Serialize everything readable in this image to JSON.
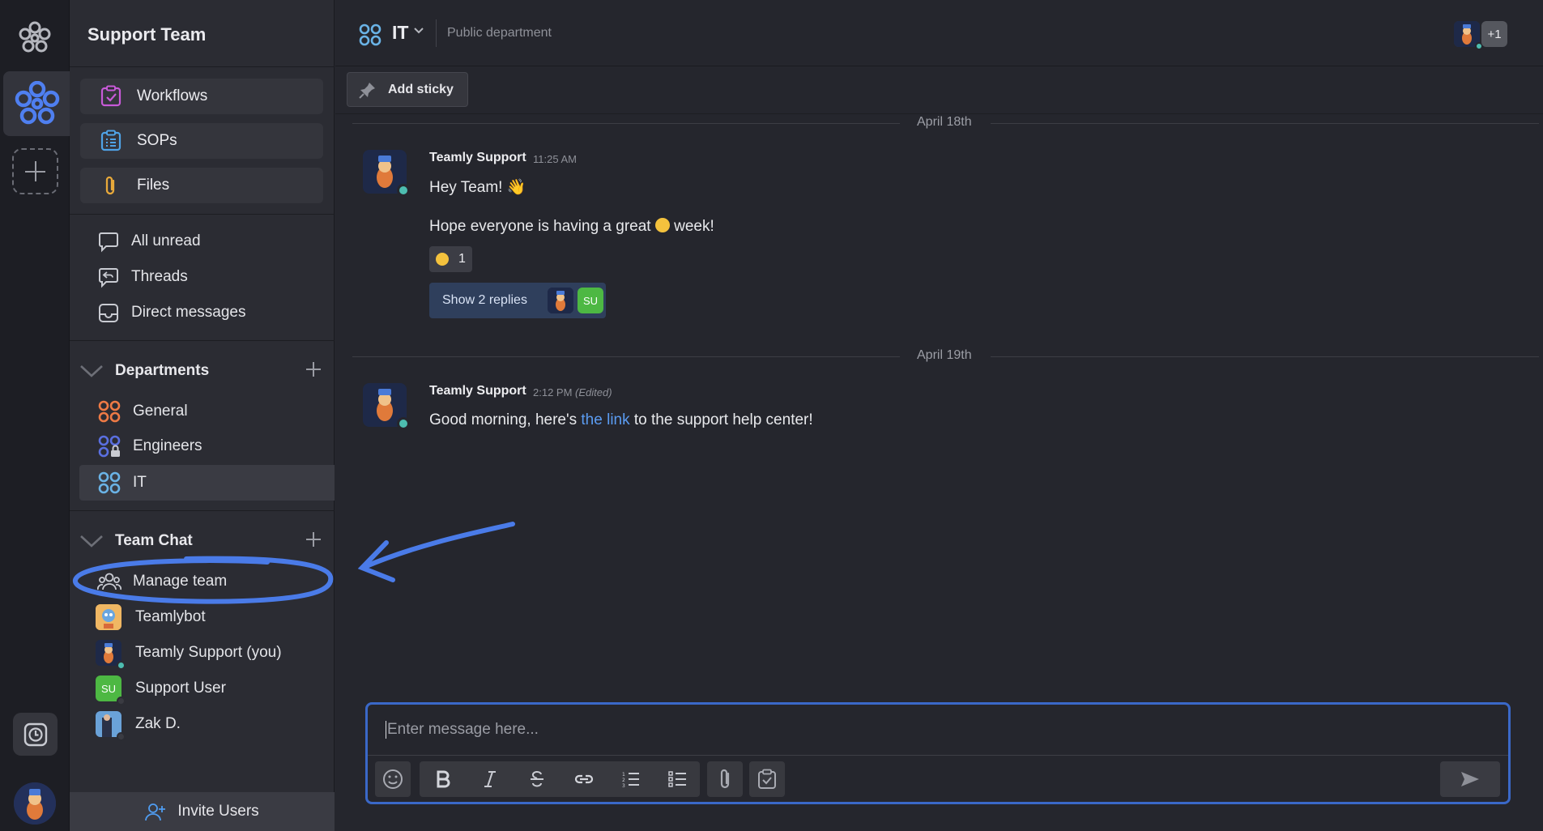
{
  "rail": {
    "home_icon": "flower-logo-icon",
    "active_workspace_icon": "flower-logo-icon",
    "add_workspace_icon": "plus-icon",
    "history_icon": "clock-icon"
  },
  "sidebar": {
    "team_title": "Support Team",
    "top_items": [
      {
        "label": "Workflows",
        "icon": "workflow-check-icon",
        "color": "#c85ad8"
      },
      {
        "label": "SOPs",
        "icon": "clipboard-list-icon",
        "color": "#4fa3e6"
      },
      {
        "label": "Files",
        "icon": "paperclip-icon",
        "color": "#e8a93a"
      }
    ],
    "nav": [
      {
        "label": "All unread",
        "icon": "chat-bubble-icon"
      },
      {
        "label": "Threads",
        "icon": "thread-reply-icon"
      },
      {
        "label": "Direct messages",
        "icon": "inbox-icon"
      }
    ],
    "departments": {
      "title": "Departments",
      "items": [
        {
          "label": "General",
          "color": "#ee7a45"
        },
        {
          "label": "Engineers",
          "color": "#5a6fe0"
        },
        {
          "label": "IT",
          "color": "#6ab3e6",
          "active": true
        }
      ]
    },
    "team_chat": {
      "title": "Team Chat",
      "manage_label": "Manage team",
      "users": [
        {
          "label": "Teamlybot",
          "avatar": "bot-avatar"
        },
        {
          "label": "Teamly Support (you)",
          "avatar": "support-avatar",
          "status": "#4dbdb0"
        },
        {
          "label": "Support User",
          "avatar": "SU",
          "status": "#3a3b42"
        },
        {
          "label": "Zak D.",
          "avatar": "zak-avatar",
          "status": "#3a3b42"
        }
      ]
    },
    "invite_label": "Invite Users"
  },
  "channel": {
    "name": "IT",
    "description": "Public department",
    "extra_members": "+1"
  },
  "toolbar": {
    "sticky_label": "Add sticky"
  },
  "messages": {
    "day1": "April 18th",
    "day2": "April 19th",
    "m1": {
      "author": "Teamly Support",
      "time": "11:25 AM",
      "line1": "Hey Team! 👋",
      "line2_a": "Hope everyone is having a great",
      "line2_b": "week!",
      "reaction_count": "1",
      "replies_label": "Show 2 replies",
      "reply_avatar_initials": "SU"
    },
    "m2": {
      "author": "Teamly Support",
      "time": "2:12 PM",
      "edited": "(Edited)",
      "text_a": "Good morning, here's",
      "link": "the link",
      "text_b": "to the support help center!"
    }
  },
  "composer": {
    "placeholder": "Enter message here...",
    "tools": [
      "emoji-icon",
      "bold-icon",
      "italic-icon",
      "strikethrough-icon",
      "link-icon",
      "ordered-list-icon",
      "bullet-list-icon",
      "attach-icon",
      "task-icon",
      "send-icon"
    ]
  },
  "colors": {
    "accent": "#3a68c8",
    "annotation": "#4a7be8",
    "link": "#5b9cf2",
    "online": "#4dbdb0"
  }
}
